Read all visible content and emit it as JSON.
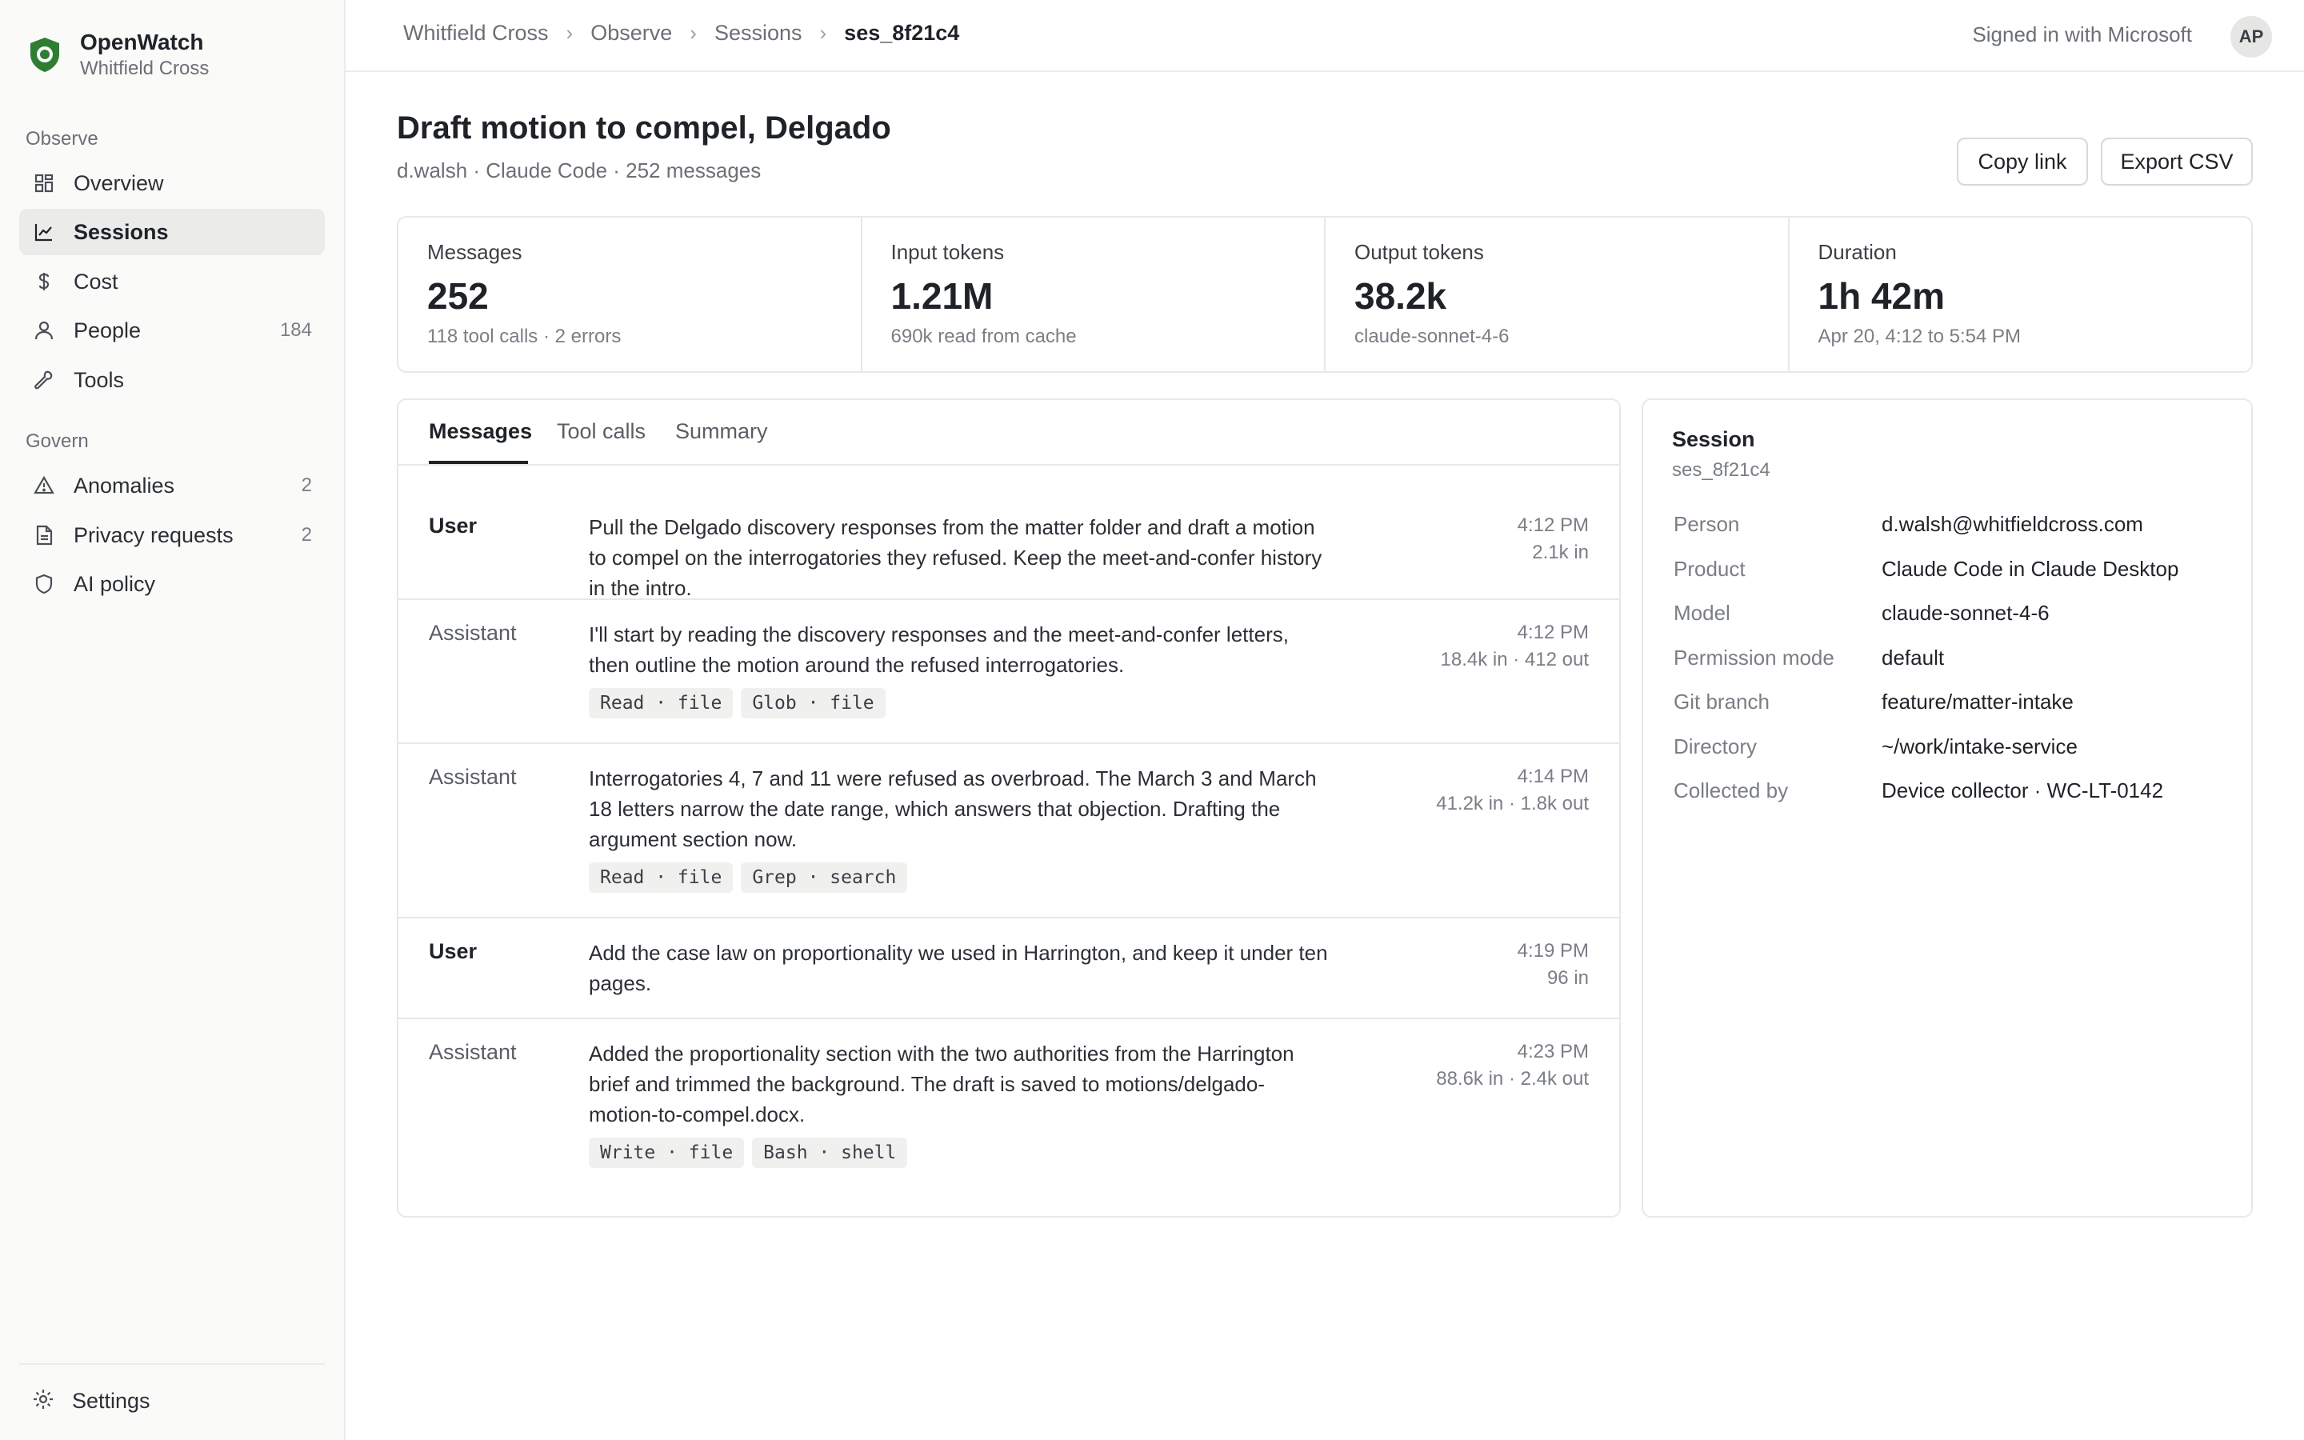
{
  "app": {
    "name": "OpenWatch",
    "org": "Whitfield Cross",
    "accent": "#2e7d32"
  },
  "sidebar": {
    "sections": [
      {
        "label": "Observe"
      },
      {
        "label": "Govern"
      }
    ],
    "items": [
      {
        "label": "Overview",
        "icon": "grid-icon"
      },
      {
        "label": "Sessions",
        "icon": "chart-line-icon",
        "active": true
      },
      {
        "label": "Cost",
        "icon": "dollar-icon"
      },
      {
        "label": "People",
        "icon": "person-icon",
        "count": "184"
      },
      {
        "label": "Tools",
        "icon": "wrench-icon"
      },
      {
        "label": "Anomalies",
        "icon": "warning-icon",
        "count": "2"
      },
      {
        "label": "Privacy requests",
        "icon": "document-icon",
        "count": "2"
      },
      {
        "label": "AI policy",
        "icon": "shield-icon"
      }
    ],
    "settings_label": "Settings"
  },
  "topbar": {
    "breadcrumb": [
      "Whitfield Cross",
      "Observe",
      "Sessions",
      "ses_8f21c4"
    ],
    "signin_text": "Signed in with Microsoft",
    "avatar_initials": "AP"
  },
  "header": {
    "title": "Draft motion to compel, Delgado",
    "subtitle": "d.walsh · Claude Code · 252 messages",
    "copy_link": "Copy link",
    "export_csv": "Export CSV"
  },
  "stats": [
    {
      "label": "Messages",
      "value": "252",
      "sub": "118 tool calls · 2 errors"
    },
    {
      "label": "Input tokens",
      "value": "1.21M",
      "sub": "690k read from cache"
    },
    {
      "label": "Output tokens",
      "value": "38.2k",
      "sub": "claude-sonnet-4-6"
    },
    {
      "label": "Duration",
      "value": "1h 42m",
      "sub": "Apr 20, 4:12 to 5:54 PM"
    }
  ],
  "tabs": [
    "Messages",
    "Tool calls",
    "Summary"
  ],
  "messages": [
    {
      "role": "User",
      "text": "Pull the Delgado discovery responses from the matter folder and draft a motion to compel on the interrogatories they refused. Keep the meet-and-confer history in the intro.",
      "time": "4:12 PM",
      "tokens": "2.1k in",
      "chips": []
    },
    {
      "role": "Assistant",
      "text": "I'll start by reading the discovery responses and the meet-and-confer letters, then outline the motion around the refused interrogatories.",
      "time": "4:12 PM",
      "tokens": "18.4k in · 412 out",
      "chips": [
        "Read · file",
        "Glob · file"
      ]
    },
    {
      "role": "Assistant",
      "text": "Interrogatories 4, 7 and 11 were refused as overbroad. The March 3 and March 18 letters narrow the date range, which answers that objection. Drafting the argument section now.",
      "time": "4:14 PM",
      "tokens": "41.2k in · 1.8k out",
      "chips": [
        "Read · file",
        "Grep · search"
      ]
    },
    {
      "role": "User",
      "text": "Add the case law on proportionality we used in Harrington, and keep it under ten pages.",
      "time": "4:19 PM",
      "tokens": "96 in",
      "chips": []
    },
    {
      "role": "Assistant",
      "text": "Added the proportionality section with the two authorities from the Harrington brief and trimmed the background. The draft is saved to motions/delgado-motion-to-compel.docx.",
      "time": "4:23 PM",
      "tokens": "88.6k in · 2.4k out",
      "chips": [
        "Write · file",
        "Bash · shell"
      ]
    }
  ],
  "session": {
    "title": "Session",
    "id": "ses_8f21c4",
    "fields": [
      {
        "key": "Person",
        "value": "d.walsh@whitfieldcross.com"
      },
      {
        "key": "Product",
        "value": "Claude Code in Claude Desktop"
      },
      {
        "key": "Model",
        "value": "claude-sonnet-4-6"
      },
      {
        "key": "Permission mode",
        "value": "default"
      },
      {
        "key": "Git branch",
        "value": "feature/matter-intake"
      },
      {
        "key": "Directory",
        "value": "~/work/intake-service"
      },
      {
        "key": "Collected by",
        "value": "Device collector · WC-LT-0142"
      }
    ]
  }
}
